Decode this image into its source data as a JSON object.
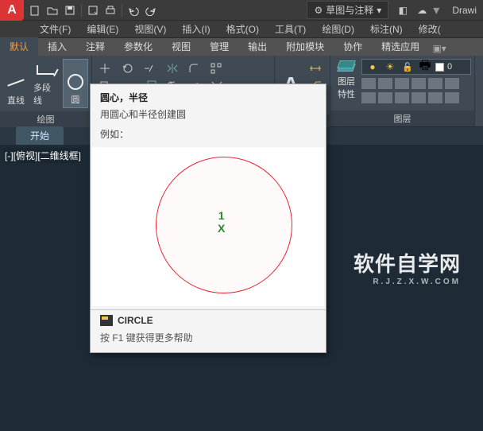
{
  "title_bar": {
    "workspace_label": "草图与注释",
    "doc_name": "Drawi"
  },
  "menus": {
    "file": "文件(F)",
    "edit": "编辑(E)",
    "view": "视图(V)",
    "insert": "插入(I)",
    "format": "格式(O)",
    "tools": "工具(T)",
    "draw": "绘图(D)",
    "dimension": "标注(N)",
    "modify": "修改("
  },
  "ribbon_tabs": {
    "default": "默认",
    "insert": "插入",
    "annotate": "注释",
    "parametric": "参数化",
    "view": "视图",
    "manage": "管理",
    "output": "输出",
    "addins": "附加模块",
    "collab": "协作",
    "featured": "精选应用"
  },
  "ribbon": {
    "line": "直线",
    "polyline": "多段线",
    "circle": "圆",
    "panel_draw": "绘图",
    "panel_layer_props": "图层\n特性",
    "panel_layer_title": "图层"
  },
  "doc_tabs": {
    "start": "开始"
  },
  "viewport": {
    "label": "[-][俯视][二维线框]"
  },
  "watermark": {
    "main": "软件自学网",
    "sub": "R.J.Z.X.W.COM"
  },
  "tooltip": {
    "title": "圆心，半径",
    "desc": "用圆心和半径创建圆",
    "example_label": "例如：",
    "center_num": "1",
    "center_mark": "X",
    "cmd_name": "CIRCLE",
    "help": "按 F1 键获得更多帮助"
  }
}
